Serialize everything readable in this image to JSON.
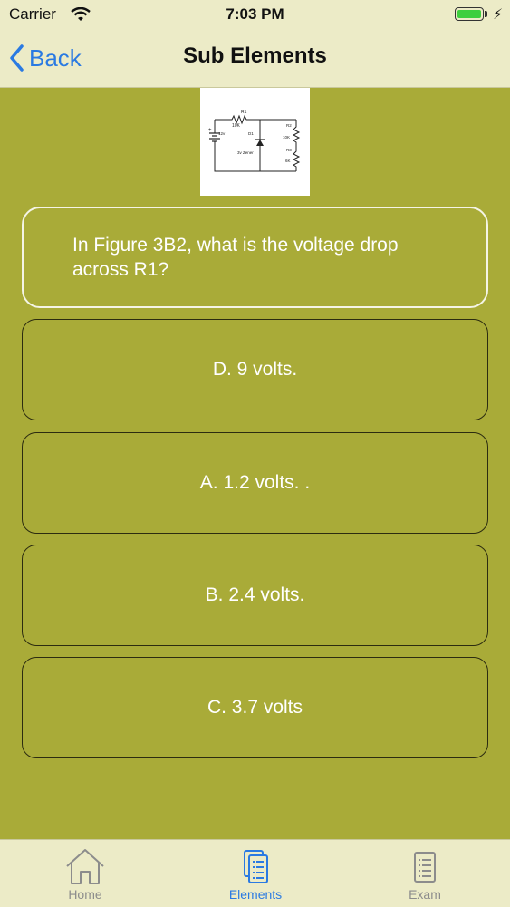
{
  "status": {
    "carrier": "Carrier",
    "time": "7:03 PM"
  },
  "nav": {
    "back_label": "Back",
    "title": "Sub Elements"
  },
  "question": {
    "text": "In Figure 3B2, what is the voltage drop across R1?"
  },
  "figure": {
    "labels": {
      "r1": "R1",
      "r1_value": "10K",
      "battery": "12v",
      "d1": "D1",
      "zener": "3v Zener",
      "r2": "R2",
      "r2_value": "10K",
      "r3": "R3",
      "r3_value": "6K"
    }
  },
  "answers": [
    {
      "label": "D. 9 volts."
    },
    {
      "label": "A. 1.2 volts. ."
    },
    {
      "label": "B. 2.4 volts."
    },
    {
      "label": "C. 3.7 volts"
    }
  ],
  "tabs": [
    {
      "label": "Home",
      "icon": "home-icon",
      "active": false
    },
    {
      "label": "Elements",
      "icon": "elements-icon",
      "active": true
    },
    {
      "label": "Exam",
      "icon": "exam-icon",
      "active": false
    }
  ],
  "colors": {
    "accent": "#2a7ae2",
    "background": "#a9ab38",
    "bar": "#ecebc7",
    "battery": "#3ecf3e"
  }
}
